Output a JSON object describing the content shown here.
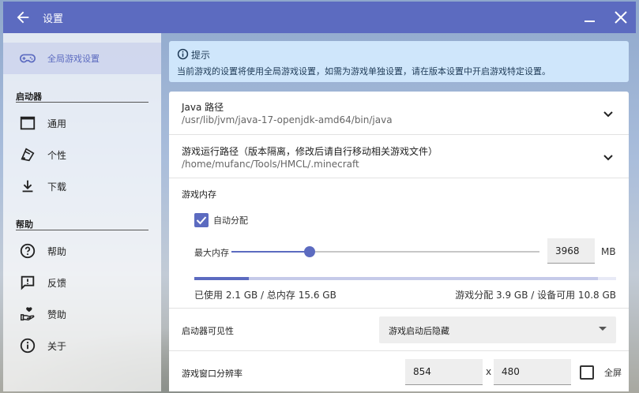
{
  "window": {
    "title": "设置",
    "theme_color": "#5c6bc0"
  },
  "sidebar": {
    "active_item": {
      "label": "全局游戏设置",
      "icon": "gamepad-icon"
    },
    "sections": [
      {
        "title": "启动器",
        "items": [
          {
            "label": "通用",
            "icon": "window-icon"
          },
          {
            "label": "个性",
            "icon": "brush-icon"
          },
          {
            "label": "下载",
            "icon": "download-icon"
          }
        ]
      },
      {
        "title": "帮助",
        "items": [
          {
            "label": "帮助",
            "icon": "help-circle-icon"
          },
          {
            "label": "反馈",
            "icon": "feedback-icon"
          },
          {
            "label": "赞助",
            "icon": "hand-heart-icon"
          },
          {
            "label": "关于",
            "icon": "info-icon"
          }
        ]
      }
    ]
  },
  "info": {
    "title": "提示",
    "message": "当前游戏的设置将使用全局游戏设置，如需为游戏单独设置，请在版本设置中开启游戏特定设置。"
  },
  "java": {
    "label": "Java 路径",
    "value": "/usr/lib/jvm/java-17-openjdk-amd64/bin/java"
  },
  "game_dir": {
    "label": "游戏运行路径（版本隔离，修改后请自行移动相关游戏文件）",
    "value": "/home/mufanc/Tools/HMCL/.minecraft"
  },
  "memory": {
    "title": "游戏内存",
    "auto_label": "自动分配",
    "auto_checked": true,
    "max_label": "最大内存",
    "value": "3968",
    "unit": "MB",
    "slider_fraction": 0.255,
    "used_fraction": 0.13,
    "allocated_fraction": 0.25,
    "used_text": "已使用 2.1 GB / 总内存 15.6 GB",
    "alloc_text": "游戏分配 3.9 GB / 设备可用 10.8 GB"
  },
  "launcher_visibility": {
    "label": "启动器可见性",
    "value": "游戏启动后隐藏"
  },
  "resolution": {
    "label": "游戏窗口分辨率",
    "width": "854",
    "separator": "x",
    "height": "480",
    "fullscreen_label": "全屏",
    "fullscreen_checked": false
  }
}
